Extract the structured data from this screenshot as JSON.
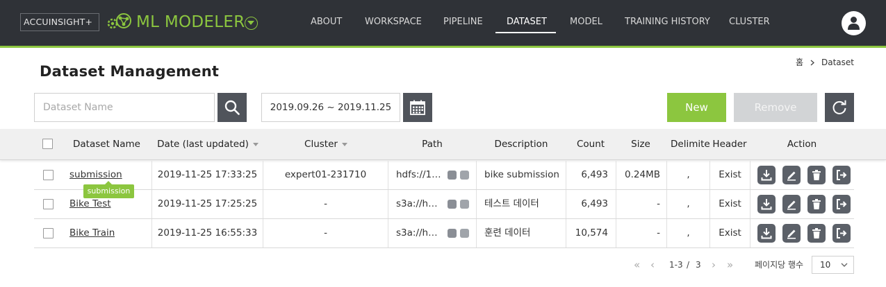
{
  "header": {
    "brand_box": "ACCUINSIGHT+",
    "app_title": "ML MODELER",
    "nav": [
      {
        "label": "ABOUT"
      },
      {
        "label": "WORKSPACE"
      },
      {
        "label": "PIPELINE"
      },
      {
        "label": "DATASET",
        "active": true
      },
      {
        "label": "MODEL"
      },
      {
        "label": "TRAINING HISTORY"
      },
      {
        "label": "CLUSTER"
      }
    ],
    "accent_color": "#8cc63f",
    "bar_color": "#2f3237"
  },
  "breadcrumb": {
    "home": "홈",
    "current": "Dataset"
  },
  "page_title": "Dataset Management",
  "toolbar": {
    "search_placeholder": "Dataset Name",
    "search_value": "",
    "date_range": "2019.09.26 ~ 2019.11.25",
    "new_label": "New",
    "remove_label": "Remove"
  },
  "table": {
    "columns": [
      "Dataset Name",
      "Date (last updated)",
      "Cluster",
      "Path",
      "Description",
      "Count",
      "Size",
      "Delimiter",
      "Header",
      "Action"
    ],
    "rows": [
      {
        "name": "submission",
        "date": "2019-11-25 17:33:25",
        "cluster": "expert01-231710",
        "path": "hdfs://1…",
        "description": "bike submission",
        "count": "6,493",
        "size": "0.24MB",
        "delimiter": ",",
        "header": "Exist"
      },
      {
        "name": "Bike Test",
        "date": "2019-11-25 17:25:25",
        "cluster": "-",
        "path": "s3a://h…",
        "description": "테스트 데이터",
        "count": "6,493",
        "size": "-",
        "delimiter": ",",
        "header": "Exist"
      },
      {
        "name": "Bike Train",
        "date": "2019-11-25 16:55:33",
        "cluster": "-",
        "path": "s3a://h…",
        "description": "훈련 데이터",
        "count": "10,574",
        "size": "-",
        "delimiter": ",",
        "header": "Exist"
      }
    ],
    "tooltip": "submission"
  },
  "pagination": {
    "current": "1-3",
    "separator": "/",
    "total": "3",
    "per_page_label": "페이지당 행수",
    "per_page_value": "10"
  }
}
